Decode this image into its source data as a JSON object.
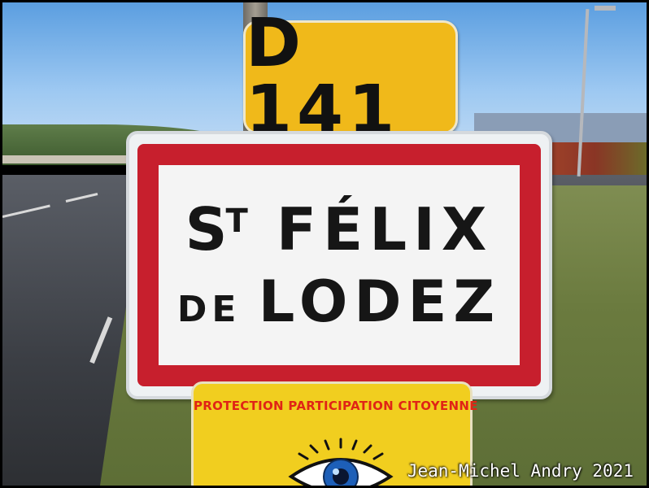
{
  "route_plate": {
    "text": "D 141"
  },
  "town_sign": {
    "line1_prefix": "S",
    "line1_sup": "T",
    "line1_name": " FÉLIX",
    "line2_prefix": "DE ",
    "line2_name": "LODEZ"
  },
  "bottom_plate": {
    "text": "PROTECTION PARTICIPATION CITOYENNE",
    "icon": "eye-icon"
  },
  "photo_credit": "Jean-Michel Andry 2021",
  "colors": {
    "sign_red": "#c71f2d",
    "route_yellow": "#f0b91a",
    "plate_yellow": "#f1ce1f"
  }
}
